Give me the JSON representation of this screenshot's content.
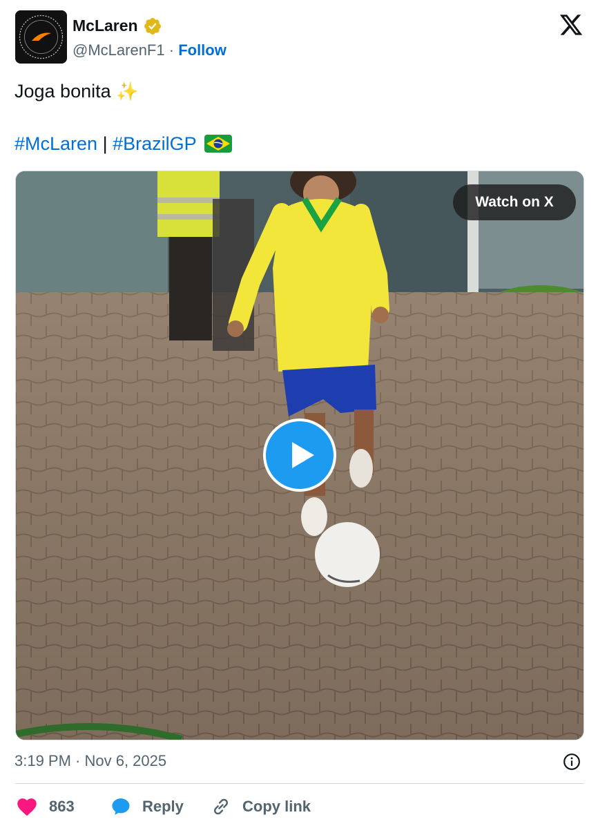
{
  "author": {
    "display_name": "McLaren",
    "handle": "@McLarenF1",
    "separator": "·",
    "follow_label": "Follow",
    "verified_color": "#e2b719"
  },
  "tweet": {
    "text": "Joga bonita",
    "sparkle_emoji": "✨",
    "hashtag_1": "#McLaren",
    "hashtag_separator": "|",
    "hashtag_2": "#BrazilGP"
  },
  "media": {
    "watch_label": "Watch on X",
    "play_icon": "play-icon"
  },
  "timestamp": "3:19 PM · Nov 6, 2025",
  "actions": {
    "like_count": "863",
    "reply_label": "Reply",
    "copy_label": "Copy link"
  },
  "colors": {
    "link": "#006fd6",
    "play_button": "#1d9bf0",
    "heart": "#f91880",
    "muted_text": "#536471"
  }
}
